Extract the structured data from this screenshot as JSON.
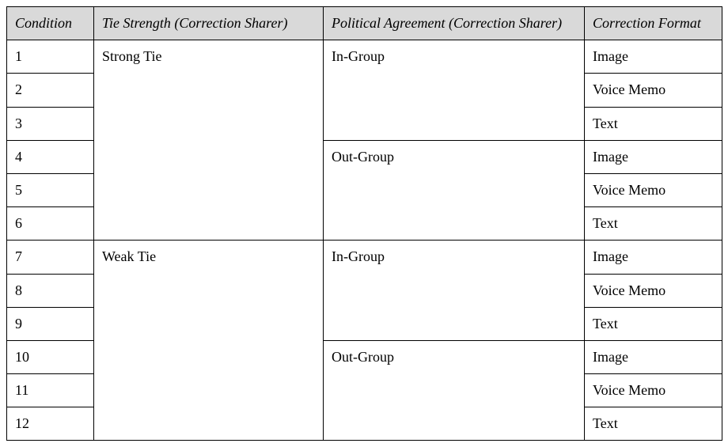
{
  "headers": {
    "condition": "Condition",
    "tie": "Tie Strength (Correction Sharer)",
    "agreement": "Political Agreement (Correction Sharer)",
    "format": "Correction Format"
  },
  "tie": {
    "strong": "Strong Tie",
    "weak": "Weak Tie"
  },
  "agreement": {
    "in": "In-Group",
    "out": "Out-Group"
  },
  "format": {
    "image": "Image",
    "voice": "Voice Memo",
    "text": "Text"
  },
  "rows": {
    "r1": "1",
    "r2": "2",
    "r3": "3",
    "r4": "4",
    "r5": "5",
    "r6": "6",
    "r7": "7",
    "r8": "8",
    "r9": "9",
    "r10": "10",
    "r11": "11",
    "r12": "12"
  }
}
